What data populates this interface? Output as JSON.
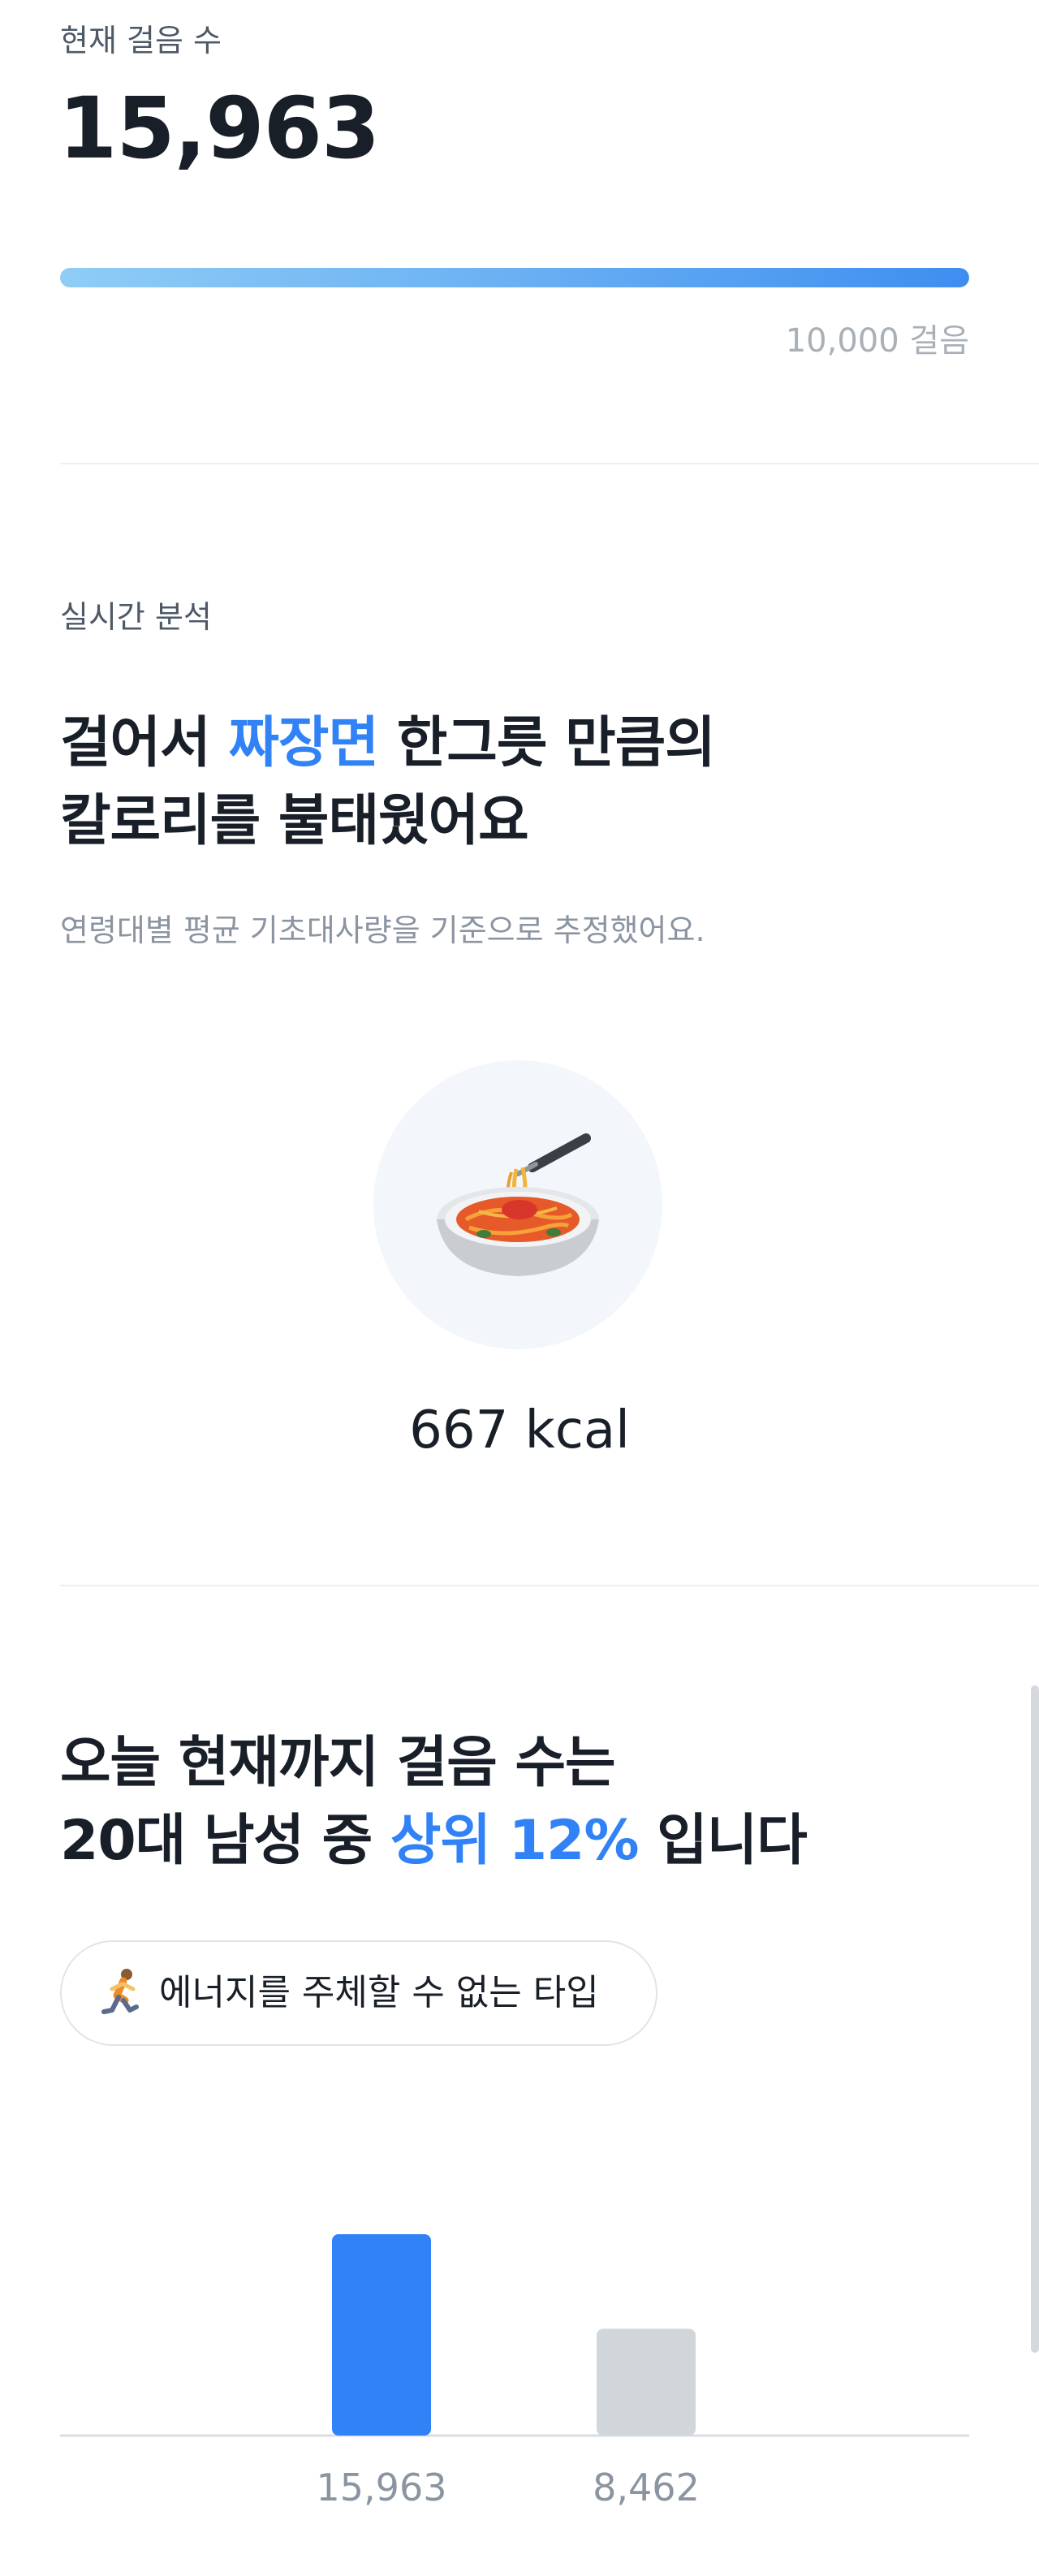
{
  "steps": {
    "label": "현재 걸음 수",
    "count": "15,963",
    "goal": "10,000 걸음",
    "progress_fraction": 1.0,
    "colors": {
      "bar_start": "#8fcdf6",
      "bar_end": "#3d8ef0"
    }
  },
  "analysis": {
    "eyebrow": "실시간 분석",
    "headline_line1_pre": "걸어서 ",
    "headline_line1_accent": "짜장면",
    "headline_line1_post": " 한그릇 만큼의",
    "headline_line2": "칼로리를 불태웠어요",
    "note": "연령대별 평균 기초대사량을 기준으로 추정했어요.",
    "food_icon": "spaghetti-bowl-icon",
    "kcal": "667 kcal",
    "accent_color": "#3182f6"
  },
  "ranking": {
    "headline_line1": "오늘 현재까지 걸음 수는",
    "headline_line2_pre": "20대 남성 중 ",
    "headline_line2_accent": "상위 12%",
    "headline_line2_post": " 입니다",
    "chip_icon": "running-person-icon",
    "chip_text": "에너지를 주체할 수 없는 타입"
  },
  "chart_data": {
    "type": "bar",
    "categories": [
      "15,963",
      "8,462"
    ],
    "values": [
      15963,
      8462
    ],
    "colors": [
      "#3182f6",
      "#d1d6db"
    ],
    "ylim": [
      0,
      15963
    ]
  }
}
